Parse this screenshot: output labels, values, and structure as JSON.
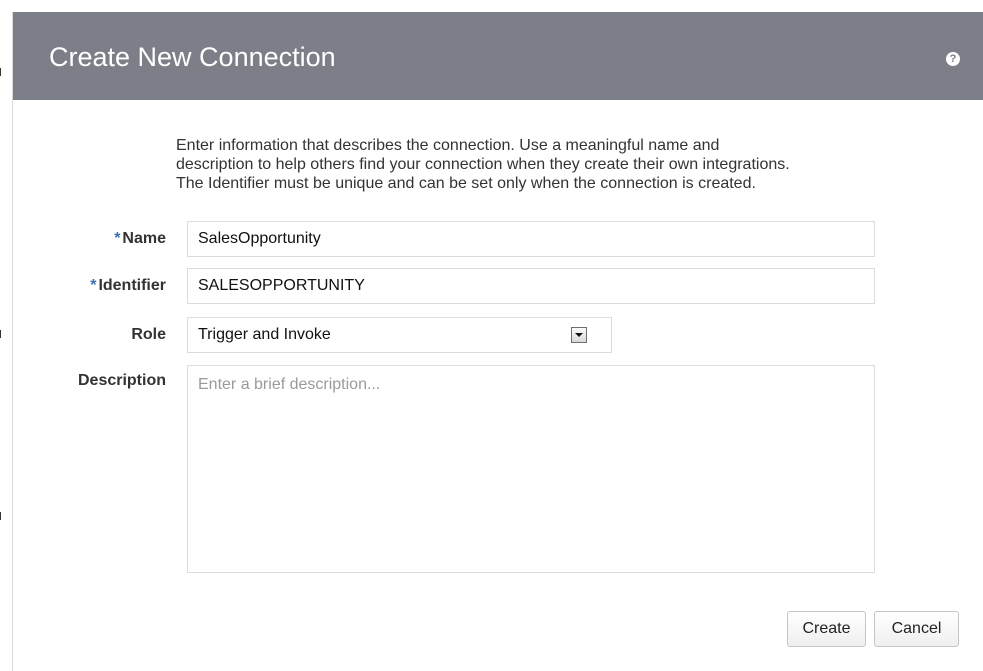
{
  "dialog": {
    "title": "Create New Connection",
    "help_icon": "help-icon"
  },
  "intro": {
    "lines": [
      "Enter information that describes the connection. Use a meaningful name and",
      "description to help others find your connection when they create their own integrations.",
      "The Identifier must be unique and can be set only when the connection is created."
    ]
  },
  "form": {
    "required_marker": "*",
    "name": {
      "label": "Name",
      "value": "SalesOpportunity"
    },
    "identifier": {
      "label": "Identifier",
      "value": "SALESOPPORTUNITY"
    },
    "role": {
      "label": "Role",
      "selected": "Trigger and Invoke",
      "icon": "chevron-down-icon"
    },
    "description": {
      "label": "Description",
      "value": "",
      "placeholder": "Enter a brief description..."
    }
  },
  "buttons": {
    "create": "Create",
    "cancel": "Cancel"
  },
  "colors": {
    "header_bg": "#7c7f87",
    "required_marker": "#3a6fb4",
    "border": "#dcdcdc"
  }
}
